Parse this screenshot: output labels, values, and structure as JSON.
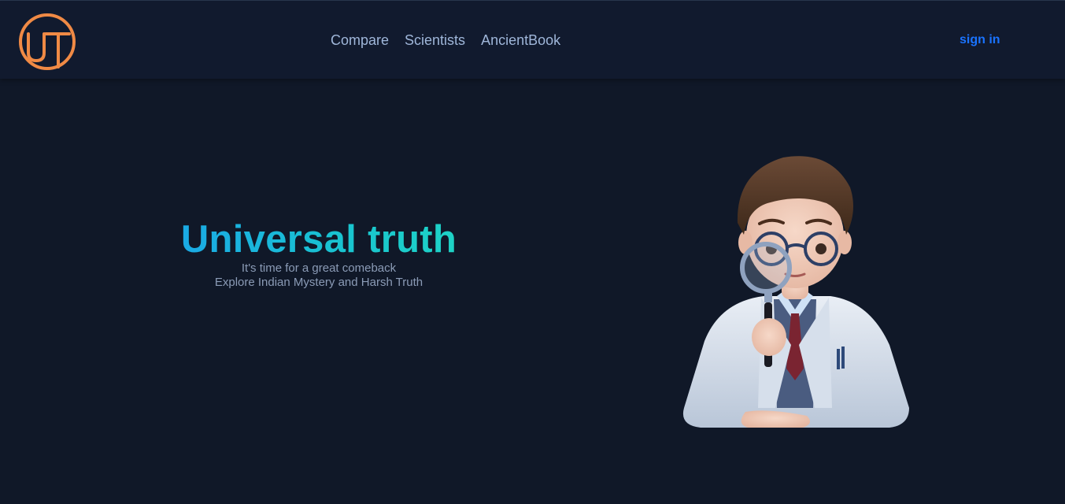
{
  "header": {
    "logo_text": "UT",
    "nav": [
      {
        "label": "Compare"
      },
      {
        "label": "Scientists"
      },
      {
        "label": "AncientBook"
      }
    ],
    "signin_label": "sign in"
  },
  "hero": {
    "title": "Universal truth",
    "line1": "It's time for a great comeback",
    "line2": "Explore Indian Mystery and Harsh Truth"
  },
  "illustration": {
    "icon": "scientist-with-magnifier-illustration"
  },
  "colors": {
    "background": "#101828",
    "header": "#111a2e",
    "accent_logo": "#f08a45",
    "nav_text": "#9fb6d9",
    "signin": "#1a73ff",
    "title_gradient_start": "#1aa6e8",
    "title_gradient_end": "#1fd6c4"
  }
}
